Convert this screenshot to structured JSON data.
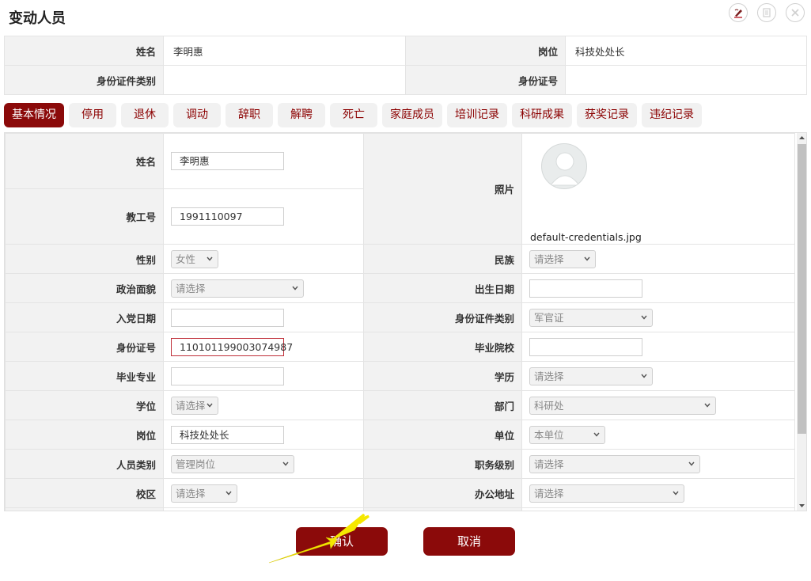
{
  "dialog": {
    "title": "变动人员"
  },
  "summary": {
    "name_label": "姓名",
    "name_value": "李明惠",
    "post_label": "岗位",
    "post_value": "科技处处长",
    "id_type_label": "身份证件类别",
    "id_type_value": "",
    "id_no_label": "身份证号",
    "id_no_value": ""
  },
  "tabs": [
    {
      "label": "基本情况",
      "active": true
    },
    {
      "label": "停用"
    },
    {
      "label": "退休"
    },
    {
      "label": "调动"
    },
    {
      "label": "辞职"
    },
    {
      "label": "解聘"
    },
    {
      "label": "死亡"
    },
    {
      "label": "家庭成员"
    },
    {
      "label": "培训记录"
    },
    {
      "label": "科研成果"
    },
    {
      "label": "获奖记录"
    },
    {
      "label": "违纪记录"
    }
  ],
  "form": {
    "name_label": "姓名",
    "name_value": "李明惠",
    "staff_no_label": "教工号",
    "staff_no_value": "1991110097",
    "photo_label": "照片",
    "photo_filename": "default-credentials.jpg",
    "gender_label": "性别",
    "gender_value": "女性",
    "ethnicity_label": "民族",
    "ethnicity_value": "请选择",
    "political_label": "政治面貌",
    "political_value": "请选择",
    "birth_label": "出生日期",
    "birth_value": "",
    "party_date_label": "入党日期",
    "party_date_value": "",
    "id_type_label": "身份证件类别",
    "id_type_value": "军官证",
    "id_no_label": "身份证号",
    "id_no_value": "110101199003074987",
    "school_label": "毕业院校",
    "school_value": "",
    "major_label": "毕业专业",
    "major_value": "",
    "education_label": "学历",
    "education_value": "请选择",
    "degree_label": "学位",
    "degree_value": "请选择",
    "dept_label": "部门",
    "dept_value": "科研处",
    "post_label": "岗位",
    "post_value": "科技处处长",
    "unit_label": "单位",
    "unit_value": "本单位",
    "staff_type_label": "人员类别",
    "staff_type_value": "管理岗位",
    "duty_level_label": "职务级别",
    "duty_level_value": "请选择",
    "campus_label": "校区",
    "campus_value": "请选择",
    "office_label": "办公地址",
    "office_value": "请选择"
  },
  "buttons": {
    "confirm": "确认",
    "cancel": "取消"
  },
  "colors": {
    "accent": "#8b0a0a",
    "tab_text": "#8b0000",
    "error_border": "#c0303a",
    "annotation_arrow": "#f5e800"
  }
}
